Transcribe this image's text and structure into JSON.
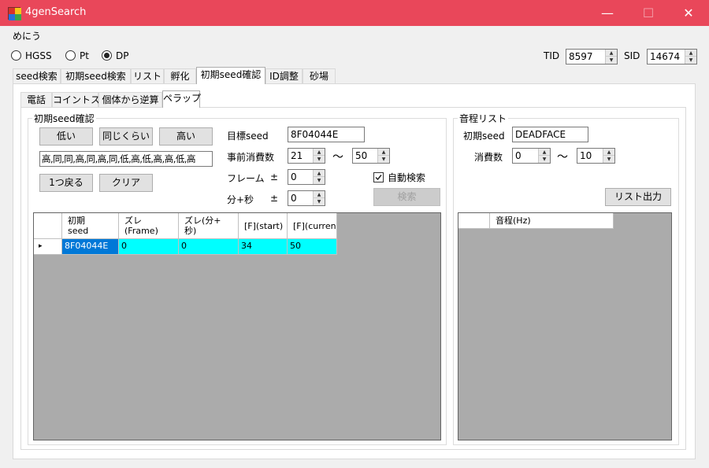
{
  "window": {
    "title": "4genSearch",
    "icon_colors": [
      "#d9302a",
      "#f5c518",
      "#2a6fd9",
      "#3aa54a"
    ]
  },
  "menu": {
    "label": "めにう"
  },
  "version_radios": [
    {
      "label": "HGSS",
      "checked": false
    },
    {
      "label": "Pt",
      "checked": false
    },
    {
      "label": "DP",
      "checked": true
    }
  ],
  "trainer": {
    "tid_label": "TID",
    "tid_value": "8597",
    "sid_label": "SID",
    "sid_value": "14674"
  },
  "main_tabs": [
    "seed検索",
    "初期seed検索",
    "リスト",
    "孵化",
    "初期seed確認",
    "ID調整",
    "砂場"
  ],
  "main_tab_active": "初期seed確認",
  "sub_tabs": [
    "電話",
    "コイントス",
    "個体から逆算",
    "ペラップ"
  ],
  "sub_tab_active": "ペラップ",
  "confirm_group": {
    "title": "初期seed確認",
    "btn_low": "低い",
    "btn_same": "同じくらい",
    "btn_high": "高い",
    "sequence": "高,同,同,高,同,高,同,低,高,低,高,高,低,高",
    "btn_back": "1つ戻る",
    "btn_clear": "クリア",
    "target_seed_label": "目標seed",
    "target_seed_value": "8F04044E",
    "pre_consume_label": "事前消費数",
    "pre_consume_min": "21",
    "range_sep": "～",
    "pre_consume_max": "50",
    "frame_label": "フレーム",
    "pm": "±",
    "frame_value": "0",
    "minsec_label": "分+秒",
    "minsec_value": "0",
    "auto_search_label": "自動検索",
    "auto_search_checked": true,
    "search_btn": "検索"
  },
  "result_grid": {
    "columns": [
      "初期\nseed",
      "ズレ\n(Frame)",
      "ズレ(分+\n秒)",
      "[F](start)",
      "[F](curren"
    ],
    "rows": [
      [
        "8F04044E",
        "0",
        "0",
        "34",
        "50"
      ]
    ],
    "row_indicator": "▸"
  },
  "pitch_group": {
    "title": "音程リスト",
    "seed_label": "初期seed",
    "seed_value": "DEADFACE",
    "consume_label": "消費数",
    "consume_min": "0",
    "range_sep": "～",
    "consume_max": "10",
    "export_btn": "リスト出力",
    "grid_column": "音程(Hz)"
  },
  "colors": {
    "titlebar": "#e9475a",
    "row_selected": "#00ffff",
    "cell_selected": "#0078d7"
  }
}
